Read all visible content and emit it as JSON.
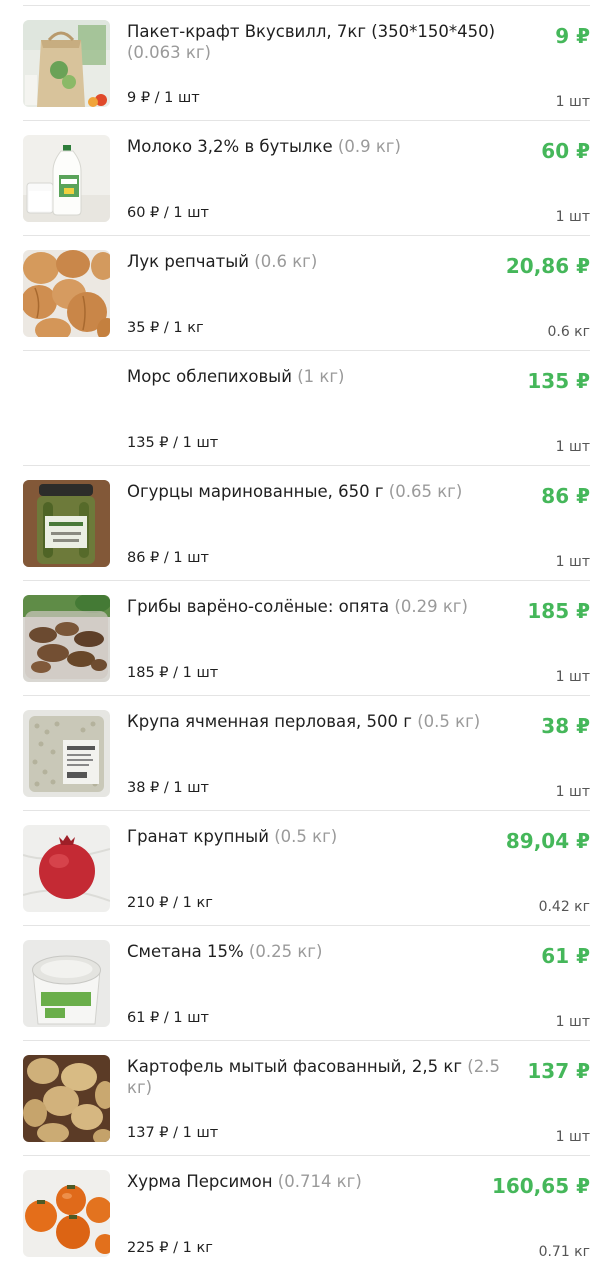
{
  "items": [
    {
      "name": "Пакет-крафт Вкусвилл, 7кг (350*150*450)",
      "weight": "(0.063 кг)",
      "price": "9 ₽",
      "unit_price": "9 ₽ / 1 шт",
      "qty": "1 шт",
      "image": "kraft-bag-image"
    },
    {
      "name": "Молоко 3,2% в бутылке",
      "weight": "(0.9 кг)",
      "price": "60 ₽",
      "unit_price": "60 ₽ / 1 шт",
      "qty": "1 шт",
      "image": "milk-bottle-image"
    },
    {
      "name": "Лук репчатый",
      "weight": "(0.6 кг)",
      "price": "20,86 ₽",
      "unit_price": "35 ₽ / 1 кг",
      "qty": "0.6 кг",
      "image": "onion-image"
    },
    {
      "name": "Морс облепиховый",
      "weight": "(1 кг)",
      "price": "135 ₽",
      "unit_price": "135 ₽ / 1 шт",
      "qty": "1 шт",
      "image": ""
    },
    {
      "name": "Огурцы маринованные, 650 г",
      "weight": "(0.65 кг)",
      "price": "86 ₽",
      "unit_price": "86 ₽ / 1 шт",
      "qty": "1 шт",
      "image": "pickles-jar-image"
    },
    {
      "name": "Грибы варёно-солёные: опята",
      "weight": "(0.29 кг)",
      "price": "185 ₽",
      "unit_price": "185 ₽ / 1 шт",
      "qty": "1 шт",
      "image": "mushrooms-image"
    },
    {
      "name": "Крупа ячменная перловая, 500 г",
      "weight": "(0.5 кг)",
      "price": "38 ₽",
      "unit_price": "38 ₽ / 1 шт",
      "qty": "1 шт",
      "image": "barley-pack-image"
    },
    {
      "name": "Гранат крупный",
      "weight": "(0.5 кг)",
      "price": "89,04 ₽",
      "unit_price": "210 ₽ / 1 кг",
      "qty": "0.42 кг",
      "image": "pomegranate-image"
    },
    {
      "name": "Сметана 15%",
      "weight": "(0.25 кг)",
      "price": "61 ₽",
      "unit_price": "61 ₽ / 1 шт",
      "qty": "1 шт",
      "image": "sour-cream-image"
    },
    {
      "name": "Картофель мытый фасованный, 2,5 кг",
      "weight": "(2.5 кг)",
      "price": "137 ₽",
      "unit_price": "137 ₽ / 1 шт",
      "qty": "1 шт",
      "image": "potatoes-image"
    },
    {
      "name": "Хурма Персимон",
      "weight": "(0.714 кг)",
      "price": "160,65 ₽",
      "unit_price": "225 ₽ / 1 кг",
      "qty": "0.71 кг",
      "image": "persimmon-image"
    }
  ],
  "colors": {
    "price": "#45b75a",
    "weight": "#9a9a9a",
    "divider": "#e4e4e4"
  }
}
